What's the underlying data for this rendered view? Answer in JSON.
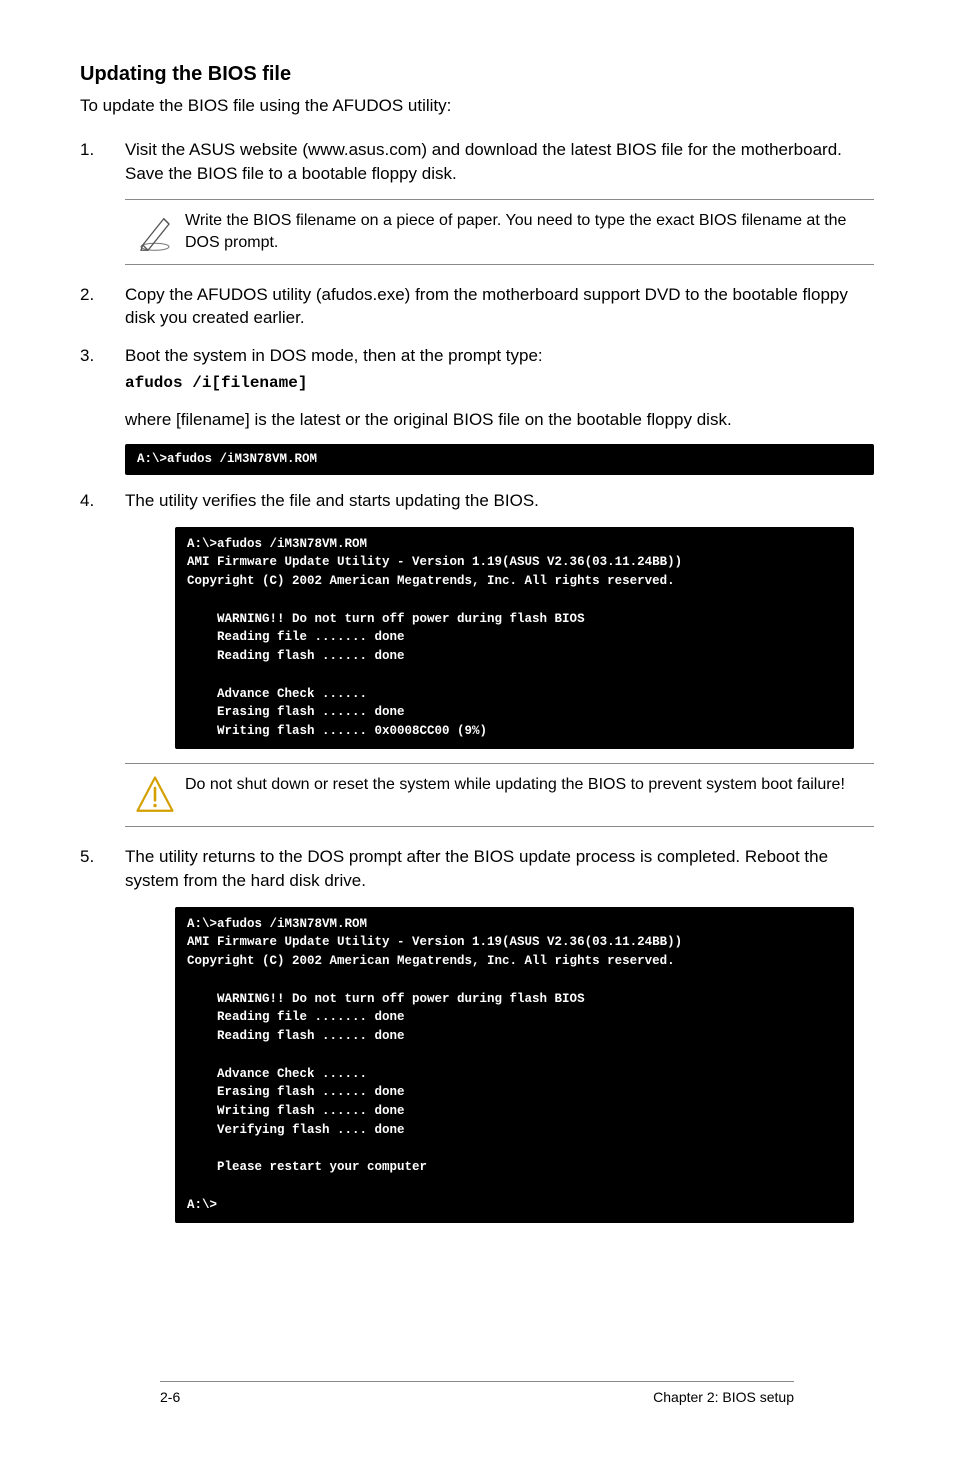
{
  "heading": "Updating the BIOS file",
  "intro": "To update the BIOS file using the AFUDOS utility:",
  "steps": {
    "s1": {
      "num": "1.",
      "text": "Visit the ASUS website (www.asus.com) and download the latest BIOS file for the motherboard. Save the BIOS file to a bootable floppy disk."
    },
    "s2": {
      "num": "2.",
      "text": "Copy the AFUDOS utility (afudos.exe) from the motherboard support DVD to the bootable floppy disk you created earlier."
    },
    "s3": {
      "num": "3.",
      "text": "Boot the system in DOS mode, then at the prompt type:",
      "code": "afudos /i[filename]"
    },
    "s3_after": "where [filename] is the latest or the original BIOS file on the bootable floppy disk.",
    "s4": {
      "num": "4.",
      "text": "The utility verifies the file and starts updating the BIOS."
    },
    "s5": {
      "num": "5.",
      "text": "The utility returns to the DOS prompt after the BIOS update process is completed. Reboot the system from the hard disk drive."
    }
  },
  "notes": {
    "pencil": "Write the BIOS filename on a piece of paper. You need to type the exact BIOS filename at the DOS prompt.",
    "warn": "Do not shut down or reset the system while updating the BIOS to prevent system boot failure!"
  },
  "terminals": {
    "t1": "A:\\>afudos /iM3N78VM.ROM",
    "t2": "A:\\>afudos /iM3N78VM.ROM\nAMI Firmware Update Utility - Version 1.19(ASUS V2.36(03.11.24BB))\nCopyright (C) 2002 American Megatrends, Inc. All rights reserved.\n\n    WARNING!! Do not turn off power during flash BIOS\n    Reading file ....... done\n    Reading flash ...... done\n\n    Advance Check ......\n    Erasing flash ...... done\n    Writing flash ...... 0x0008CC00 (9%)",
    "t3": "A:\\>afudos /iM3N78VM.ROM\nAMI Firmware Update Utility - Version 1.19(ASUS V2.36(03.11.24BB))\nCopyright (C) 2002 American Megatrends, Inc. All rights reserved.\n\n    WARNING!! Do not turn off power during flash BIOS\n    Reading file ....... done\n    Reading flash ...... done\n\n    Advance Check ......\n    Erasing flash ...... done\n    Writing flash ...... done\n    Verifying flash .... done\n\n    Please restart your computer\n\nA:\\>"
  },
  "footer": {
    "left": "2-6",
    "right": "Chapter 2: BIOS setup"
  }
}
